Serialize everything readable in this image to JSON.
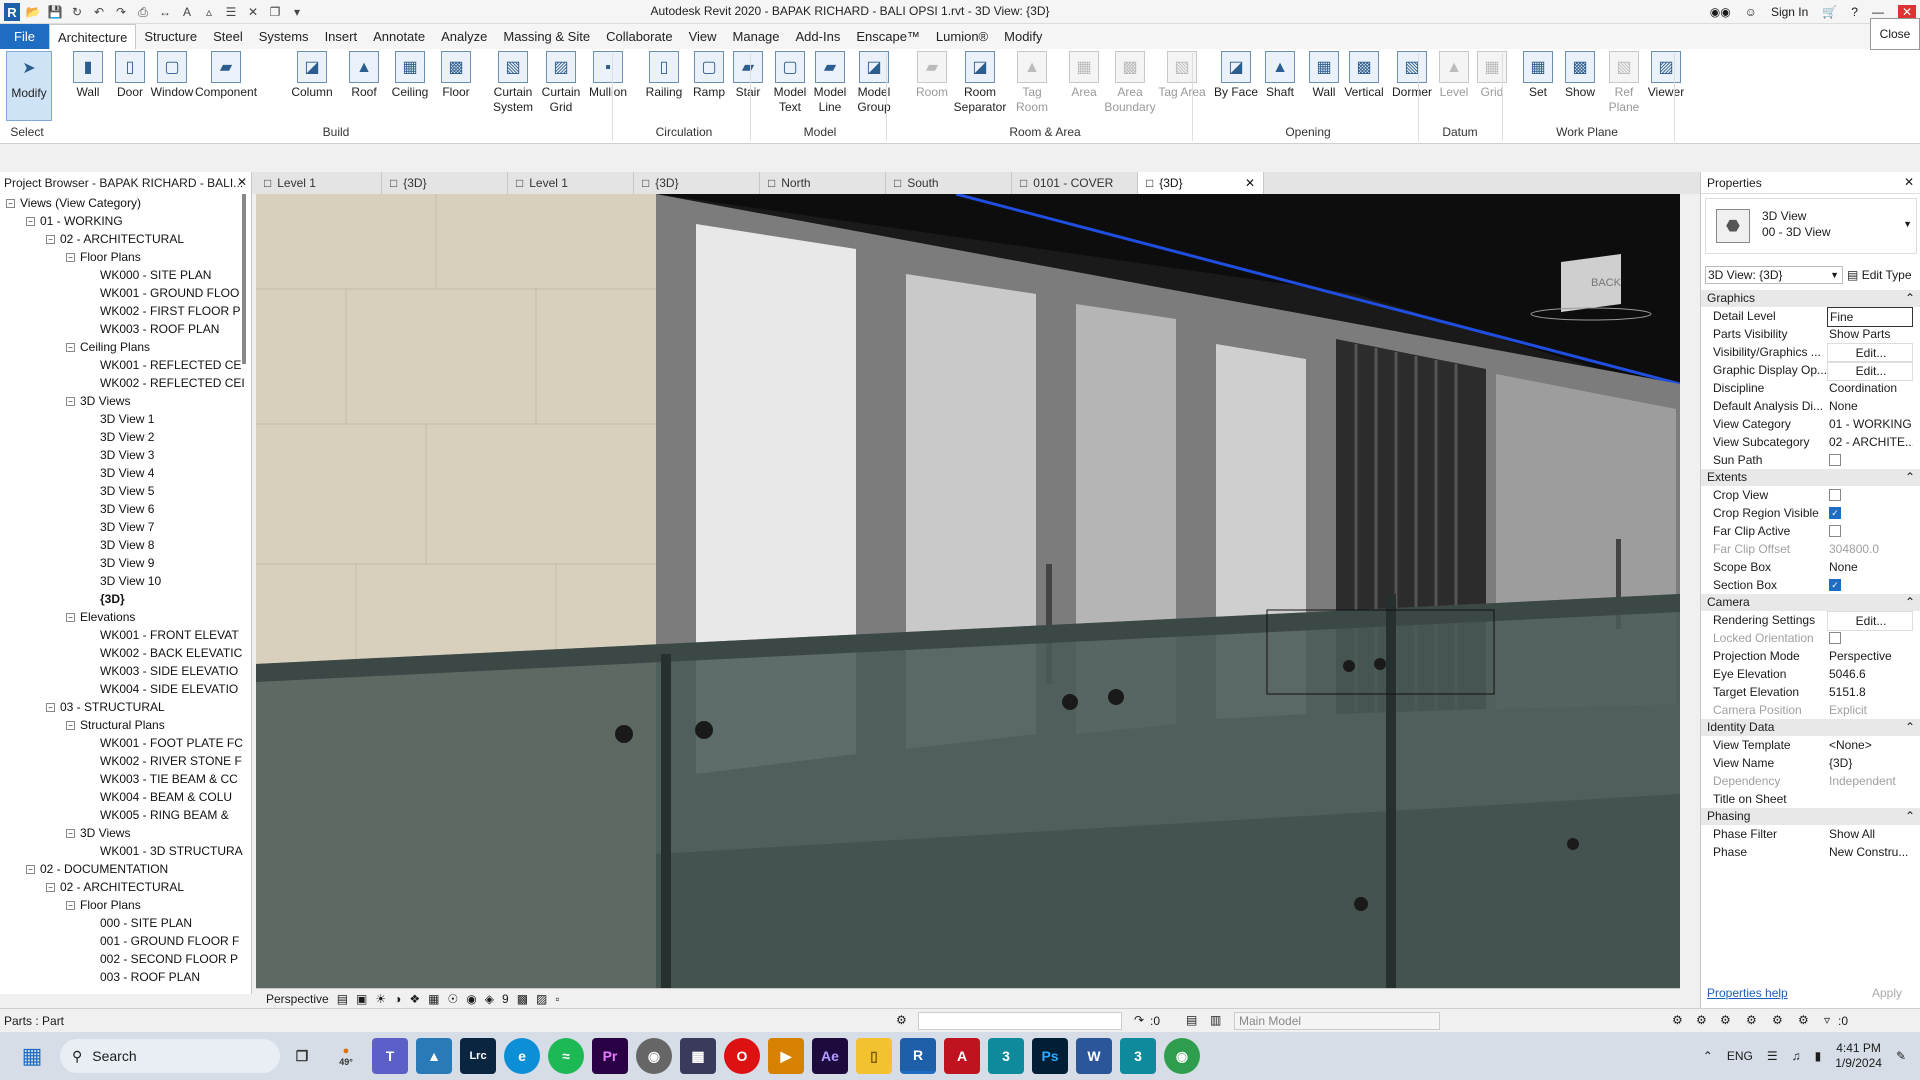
{
  "title": "Autodesk Revit 2020 - BAPAK RICHARD - BALI OPSI 1.rvt - 3D View: {3D}",
  "sign_in": "Sign In",
  "close_tooltip": "Close",
  "menu": [
    "File",
    "Architecture",
    "Structure",
    "Steel",
    "Systems",
    "Insert",
    "Annotate",
    "Analyze",
    "Massing & Site",
    "Collaborate",
    "View",
    "Manage",
    "Add-Ins",
    "Enscape™",
    "Lumion®",
    "Modify"
  ],
  "ribbon": {
    "select": {
      "modify": "Modify",
      "label": "Select"
    },
    "build": {
      "label": "Build",
      "tools": [
        "Wall",
        "Door",
        "Window",
        "Component",
        "Column",
        "Roof",
        "Ceiling",
        "Floor",
        "Curtain System",
        "Curtain Grid",
        "Mullion"
      ]
    },
    "circulation": {
      "label": "Circulation",
      "tools": [
        "Railing",
        "Ramp",
        "Stair"
      ]
    },
    "model": {
      "label": "Model",
      "tools": [
        "Model Text",
        "Model Line",
        "Model Group"
      ]
    },
    "room": {
      "label": "Room & Area",
      "tools": [
        "Room",
        "Room Separator",
        "Tag Room",
        "Area",
        "Area Boundary",
        "Tag Area"
      ]
    },
    "opening": {
      "label": "Opening",
      "tools": [
        "By Face",
        "Shaft",
        "Wall",
        "Vertical",
        "Dormer"
      ]
    },
    "datum": {
      "label": "Datum",
      "tools": [
        "Level",
        "Grid"
      ]
    },
    "workplane": {
      "label": "Work Plane",
      "tools": [
        "Set",
        "Show",
        "Ref Plane",
        "Viewer"
      ]
    }
  },
  "browser": {
    "title": "Project Browser - BAPAK RICHARD - BALI...",
    "nodes": [
      {
        "t": "Views (View Category)",
        "l": 0,
        "b": "-"
      },
      {
        "t": "01 - WORKING",
        "l": 1,
        "b": "-"
      },
      {
        "t": "02 - ARCHITECTURAL",
        "l": 2,
        "b": "-"
      },
      {
        "t": "Floor Plans",
        "l": 3,
        "b": "-"
      },
      {
        "t": "WK000 - SITE PLAN",
        "l": 4
      },
      {
        "t": "WK001 - GROUND FLOO",
        "l": 4
      },
      {
        "t": "WK002 - FIRST FLOOR P",
        "l": 4
      },
      {
        "t": "WK003 - ROOF PLAN",
        "l": 4
      },
      {
        "t": "Ceiling Plans",
        "l": 3,
        "b": "-"
      },
      {
        "t": "WK001 -  REFLECTED CE",
        "l": 4
      },
      {
        "t": "WK002 - REFLECTED CEI",
        "l": 4
      },
      {
        "t": "3D Views",
        "l": 3,
        "b": "-"
      },
      {
        "t": "3D View 1",
        "l": 4
      },
      {
        "t": "3D View 2",
        "l": 4
      },
      {
        "t": "3D View 3",
        "l": 4
      },
      {
        "t": "3D View 4",
        "l": 4
      },
      {
        "t": "3D View 5",
        "l": 4
      },
      {
        "t": "3D View 6",
        "l": 4
      },
      {
        "t": "3D View 7",
        "l": 4
      },
      {
        "t": "3D View 8",
        "l": 4
      },
      {
        "t": "3D View 9",
        "l": 4
      },
      {
        "t": "3D View 10",
        "l": 4
      },
      {
        "t": "{3D}",
        "l": 4,
        "bold": true
      },
      {
        "t": "Elevations",
        "l": 3,
        "b": "-"
      },
      {
        "t": "WK001 - FRONT ELEVAT",
        "l": 4
      },
      {
        "t": "WK002 - BACK ELEVATIC",
        "l": 4
      },
      {
        "t": "WK003 - SIDE ELEVATIO",
        "l": 4
      },
      {
        "t": "WK004 - SIDE ELEVATIO",
        "l": 4
      },
      {
        "t": "03 - STRUCTURAL",
        "l": 2,
        "b": "-"
      },
      {
        "t": "Structural Plans",
        "l": 3,
        "b": "-"
      },
      {
        "t": "WK001 - FOOT PLATE FC",
        "l": 4
      },
      {
        "t": "WK002 - RIVER STONE F",
        "l": 4
      },
      {
        "t": "WK003 - TIE BEAM & CC",
        "l": 4
      },
      {
        "t": "WK004 - BEAM & COLU",
        "l": 4
      },
      {
        "t": "WK005 - RING BEAM &",
        "l": 4
      },
      {
        "t": "3D Views",
        "l": 3,
        "b": "-"
      },
      {
        "t": "WK001 - 3D STRUCTURA",
        "l": 4
      },
      {
        "t": "02 - DOCUMENTATION",
        "l": 1,
        "b": "-"
      },
      {
        "t": "02 - ARCHITECTURAL",
        "l": 2,
        "b": "-"
      },
      {
        "t": "Floor Plans",
        "l": 3,
        "b": "-"
      },
      {
        "t": "000 - SITE PLAN",
        "l": 4
      },
      {
        "t": "001 - GROUND FLOOR F",
        "l": 4
      },
      {
        "t": "002 - SECOND FLOOR P",
        "l": 4
      },
      {
        "t": "003 - ROOF PLAN",
        "l": 4
      }
    ]
  },
  "view_tabs": [
    "Level 1",
    "{3D}",
    "Level 1",
    "{3D}",
    "North",
    "South",
    "0101 - COVER",
    "{3D}"
  ],
  "viewcube": {
    "face": "BACK"
  },
  "viewbar": {
    "mode": "Perspective",
    "scale_value": "9"
  },
  "properties": {
    "title": "Properties",
    "type_line1": "3D View",
    "type_line2": "00 - 3D View",
    "selector": "3D View: {3D}",
    "edit_type": "Edit Type",
    "sections": [
      {
        "name": "Graphics",
        "rows": [
          [
            "Detail Level",
            "Fine"
          ],
          [
            "Parts Visibility",
            "Show Parts"
          ],
          [
            "Visibility/Graphics ...",
            "Edit..."
          ],
          [
            "Graphic Display Op...",
            "Edit..."
          ],
          [
            "Discipline",
            "Coordination"
          ],
          [
            "Default Analysis Di...",
            "None"
          ],
          [
            "View Category",
            "01 - WORKING"
          ],
          [
            "View Subcategory",
            "02 - ARCHITE..."
          ],
          [
            "Sun Path",
            "cb:0"
          ]
        ]
      },
      {
        "name": "Extents",
        "rows": [
          [
            "Crop View",
            "cb:0"
          ],
          [
            "Crop Region Visible",
            "cb:1"
          ],
          [
            "Far Clip Active",
            "cb:0"
          ],
          [
            "Far Clip Offset",
            "304800.0",
            "dim"
          ],
          [
            "Scope Box",
            "None"
          ],
          [
            "Section Box",
            "cb:1"
          ]
        ]
      },
      {
        "name": "Camera",
        "rows": [
          [
            "Rendering Settings",
            "Edit..."
          ],
          [
            "Locked Orientation",
            "cb:0",
            "dim"
          ],
          [
            "Projection Mode",
            "Perspective"
          ],
          [
            "Eye Elevation",
            "5046.6"
          ],
          [
            "Target Elevation",
            "5151.8"
          ],
          [
            "Camera Position",
            "Explicit",
            "dim"
          ]
        ]
      },
      {
        "name": "Identity Data",
        "rows": [
          [
            "View Template",
            "<None>"
          ],
          [
            "View Name",
            "{3D}"
          ],
          [
            "Dependency",
            "Independent",
            "dim"
          ],
          [
            "Title on Sheet",
            ""
          ]
        ]
      },
      {
        "name": "Phasing",
        "rows": [
          [
            "Phase Filter",
            "Show All"
          ],
          [
            "Phase",
            "New Constru..."
          ]
        ]
      }
    ],
    "help": "Properties help",
    "apply": "Apply"
  },
  "status": {
    "left": "Parts : Part",
    "workset_count": ":0",
    "model": "Main Model",
    "filter_count": ":0"
  },
  "taskbar": {
    "search": "Search",
    "weather": "49°",
    "lang": "ENG",
    "time": "4:41 PM",
    "date": "1/9/2024"
  },
  "colors": {
    "accent": "#1f6dc2",
    "file_tab": "#1f6dc2"
  }
}
